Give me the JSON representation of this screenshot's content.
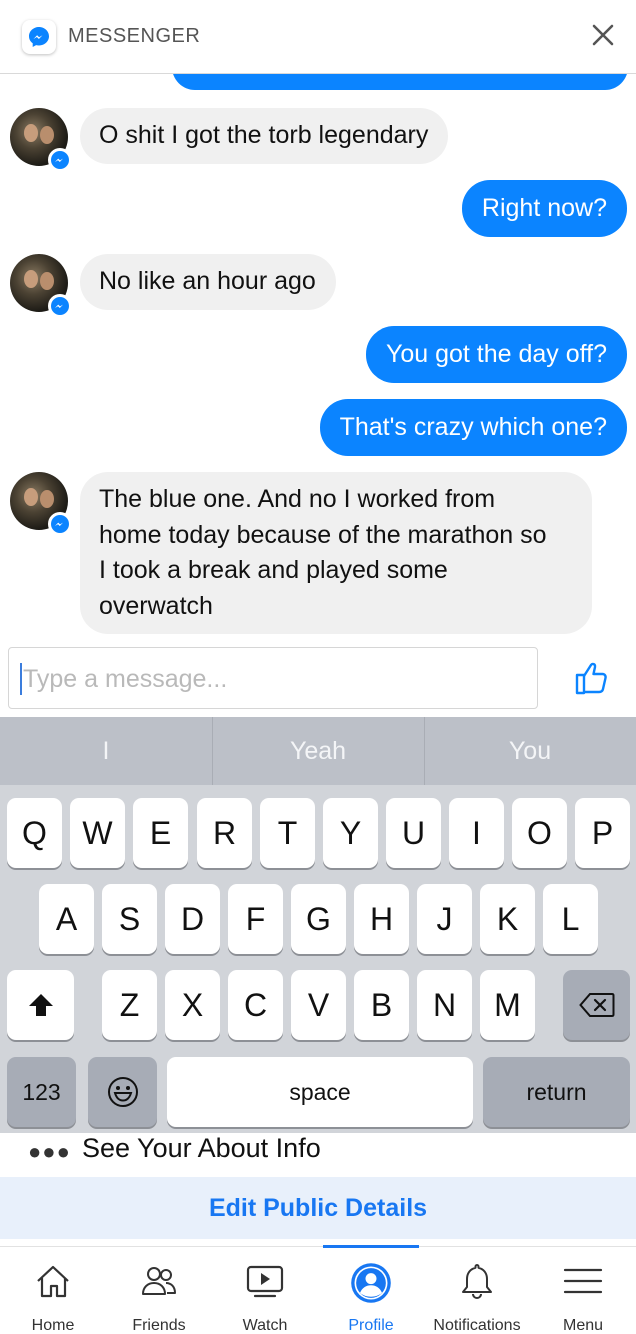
{
  "header": {
    "title": "MESSENGER"
  },
  "chat": {
    "messages": [
      {
        "dir": "in",
        "text": "O shit I got the torb legendary"
      },
      {
        "dir": "out",
        "text": "Right now?"
      },
      {
        "dir": "in",
        "text": "No like an hour ago"
      },
      {
        "dir": "out",
        "text": "You got the day off?"
      },
      {
        "dir": "out",
        "text": "That's crazy which one?"
      },
      {
        "dir": "in",
        "lines": [
          "The blue one. And no I worked from",
          "home today because of the marathon so",
          "I took a break and played some",
          "overwatch"
        ]
      }
    ]
  },
  "composer": {
    "placeholder": "Type a message..."
  },
  "keyboard": {
    "suggestions": [
      "I",
      "Yeah",
      "You"
    ],
    "row1": [
      "Q",
      "W",
      "E",
      "R",
      "T",
      "Y",
      "U",
      "I",
      "O",
      "P"
    ],
    "row2": [
      "A",
      "S",
      "D",
      "F",
      "G",
      "H",
      "J",
      "K",
      "L"
    ],
    "row3": [
      "Z",
      "X",
      "C",
      "V",
      "B",
      "N",
      "M"
    ],
    "numbers_label": "123",
    "space_label": "space",
    "return_label": "return"
  },
  "profile": {
    "about_label": "See Your About Info",
    "edit_label": "Edit Public Details"
  },
  "tabs": [
    {
      "label": "Home",
      "icon": "home-icon"
    },
    {
      "label": "Friends",
      "icon": "friends-icon"
    },
    {
      "label": "Watch",
      "icon": "watch-icon"
    },
    {
      "label": "Profile",
      "icon": "profile-icon",
      "active": true
    },
    {
      "label": "Notifications",
      "icon": "bell-icon"
    },
    {
      "label": "Menu",
      "icon": "menu-icon"
    }
  ],
  "colors": {
    "accent": "#1877f2",
    "bubble_out": "#0b84ff",
    "bubble_in": "#f0f0f0",
    "keyboard_bg": "#d1d4d9"
  }
}
